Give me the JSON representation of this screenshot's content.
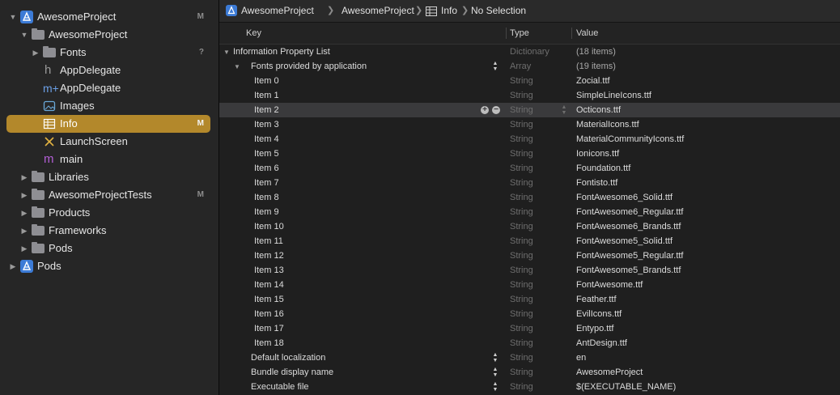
{
  "navigator": {
    "items": [
      {
        "label": "AwesomeProject",
        "badge": "M",
        "icon": "xcode-project-icon"
      },
      {
        "label": "AwesomeProject",
        "badge": "",
        "icon": "folder-icon"
      },
      {
        "label": "Fonts",
        "badge": "?",
        "icon": "folder-icon"
      },
      {
        "label": "AppDelegate",
        "badge": "",
        "icon": "header-file-icon"
      },
      {
        "label": "AppDelegate",
        "badge": "",
        "icon": "objc-file-icon"
      },
      {
        "label": "Images",
        "badge": "",
        "icon": "asset-catalog-icon"
      },
      {
        "label": "Info",
        "badge": "M",
        "icon": "plist-table-icon"
      },
      {
        "label": "LaunchScreen",
        "badge": "",
        "icon": "storyboard-icon"
      },
      {
        "label": "main",
        "badge": "",
        "icon": "objc-file-icon"
      },
      {
        "label": "Libraries",
        "badge": "",
        "icon": "folder-icon"
      },
      {
        "label": "AwesomeProjectTests",
        "badge": "M",
        "icon": "folder-icon"
      },
      {
        "label": "Products",
        "badge": "",
        "icon": "folder-icon"
      },
      {
        "label": "Frameworks",
        "badge": "",
        "icon": "folder-icon"
      },
      {
        "label": "Pods",
        "badge": "",
        "icon": "folder-icon"
      },
      {
        "label": "Pods",
        "badge": "",
        "icon": "xcode-project-icon"
      }
    ],
    "header_glyph": "h",
    "objc_glyph": "m",
    "objc_plus_glyph": "m+"
  },
  "breadcrumb": {
    "items": [
      "AwesomeProject",
      "AwesomeProject",
      "Info",
      "No Selection"
    ],
    "separator": "❯"
  },
  "columns": {
    "key": "Key",
    "type": "Type",
    "value": "Value"
  },
  "plist": {
    "rows": [
      {
        "key": "Information Property List",
        "type": "Dictionary",
        "value": "(18 items)"
      },
      {
        "key": "Fonts provided by application",
        "type": "Array",
        "value": "(19 items)"
      },
      {
        "key": "Item 0",
        "type": "String",
        "value": "Zocial.ttf"
      },
      {
        "key": "Item 1",
        "type": "String",
        "value": "SimpleLineIcons.ttf"
      },
      {
        "key": "Item 2",
        "type": "String",
        "value": "Octicons.ttf"
      },
      {
        "key": "Item 3",
        "type": "String",
        "value": "MaterialIcons.ttf"
      },
      {
        "key": "Item 4",
        "type": "String",
        "value": "MaterialCommunityIcons.ttf"
      },
      {
        "key": "Item 5",
        "type": "String",
        "value": "Ionicons.ttf"
      },
      {
        "key": "Item 6",
        "type": "String",
        "value": "Foundation.ttf"
      },
      {
        "key": "Item 7",
        "type": "String",
        "value": "Fontisto.ttf"
      },
      {
        "key": "Item 8",
        "type": "String",
        "value": "FontAwesome6_Solid.ttf"
      },
      {
        "key": "Item 9",
        "type": "String",
        "value": "FontAwesome6_Regular.ttf"
      },
      {
        "key": "Item 10",
        "type": "String",
        "value": "FontAwesome6_Brands.ttf"
      },
      {
        "key": "Item 11",
        "type": "String",
        "value": "FontAwesome5_Solid.ttf"
      },
      {
        "key": "Item 12",
        "type": "String",
        "value": "FontAwesome5_Regular.ttf"
      },
      {
        "key": "Item 13",
        "type": "String",
        "value": "FontAwesome5_Brands.ttf"
      },
      {
        "key": "Item 14",
        "type": "String",
        "value": "FontAwesome.ttf"
      },
      {
        "key": "Item 15",
        "type": "String",
        "value": "Feather.ttf"
      },
      {
        "key": "Item 16",
        "type": "String",
        "value": "EvilIcons.ttf"
      },
      {
        "key": "Item 17",
        "type": "String",
        "value": "Entypo.ttf"
      },
      {
        "key": "Item 18",
        "type": "String",
        "value": "AntDesign.ttf"
      },
      {
        "key": "Default localization",
        "type": "String",
        "value": "en"
      },
      {
        "key": "Bundle display name",
        "type": "String",
        "value": "AwesomeProject"
      },
      {
        "key": "Executable file",
        "type": "String",
        "value": "$(EXECUTABLE_NAME)"
      }
    ]
  },
  "colors": {
    "selection": "#b3882b",
    "project_icon": "#3c7bd6",
    "objc_glyph": "#b35fd6"
  }
}
